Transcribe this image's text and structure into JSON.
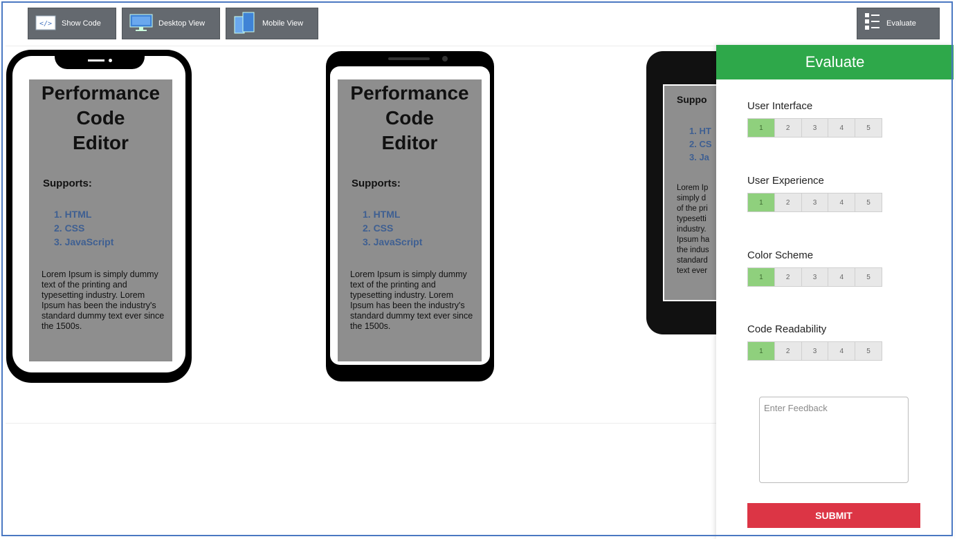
{
  "toolbar": {
    "show_code": "Show Code",
    "desktop_view": "Desktop View",
    "mobile_view": "Mobile View",
    "evaluate": "Evaluate"
  },
  "preview": {
    "title": "Performance Code Editor",
    "title_lines": [
      "Performance",
      "Code",
      "Editor"
    ],
    "supports_label": "Supports:",
    "languages": [
      "1. HTML",
      "2. CSS",
      "3. JavaScript"
    ],
    "lorem": "Lorem Ipsum is simply dummy text of the printing and typesetting industry. Lorem Ipsum has been the industry's standard dummy text ever since the 1500s.",
    "third_phone": {
      "supports_label": "Suppo",
      "languages": [
        "1. HT",
        "2. CS",
        "3. Ja"
      ],
      "lorem_lines": [
        "Lorem Ip",
        "simply d",
        "of the pri",
        "typesetti",
        "industry.",
        "Ipsum ha",
        "the indus",
        "standard",
        "text ever"
      ]
    }
  },
  "evaluate_panel": {
    "title": "Evaluate",
    "criteria": [
      {
        "label": "User Interface",
        "selected": 1
      },
      {
        "label": "User Experience",
        "selected": 1
      },
      {
        "label": "Color Scheme",
        "selected": 1
      },
      {
        "label": "Code Readability",
        "selected": 1
      }
    ],
    "scale": [
      "1",
      "2",
      "3",
      "4",
      "5"
    ],
    "feedback_placeholder": "Enter Feedback",
    "submit_label": "SUBMIT"
  },
  "colors": {
    "panel_header": "#2ea84a",
    "submit": "#dc3545",
    "rating_selected": "#8fd07d",
    "toolbar_button": "#64696f",
    "preview_background": "#8e8e8e",
    "list_text": "#3e5f92"
  }
}
